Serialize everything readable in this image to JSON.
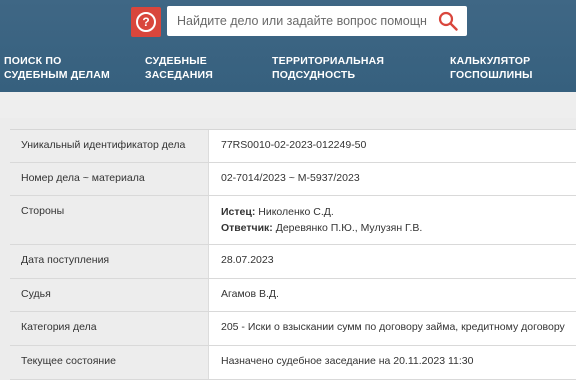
{
  "header": {
    "help_icon": "question-circle-icon",
    "search": {
      "placeholder": "Найдите дело или задайте вопрос помощнику",
      "value": ""
    },
    "search_icon": "search-icon",
    "nav": [
      {
        "label": "ПОИСК ПО\nСУДЕБНЫМ ДЕЛАМ"
      },
      {
        "label": "СУДЕБНЫЕ\nЗАСЕДАНИЯ"
      },
      {
        "label": "ТЕРРИТОРИАЛЬНАЯ\nПОДСУДНОСТЬ"
      },
      {
        "label": "КАЛЬКУЛЯТОР\nГОСПОШЛИНЫ"
      }
    ]
  },
  "case": {
    "id_label": "Уникальный идентификатор дела",
    "id_value": "77RS0010-02-2023-012249-50",
    "number_label": "Номер дела ~ материала",
    "number_value": "02-7014/2023 ~ М-5937/2023",
    "parties_label": "Стороны",
    "plaintiff_label": "Истец:",
    "plaintiff_value": "Николенко С.Д.",
    "defendant_label": "Ответчик:",
    "defendant_value": "Деревянко П.Ю., Мулузян Г.В.",
    "received_label": "Дата поступления",
    "received_value": "28.07.2023",
    "judge_label": "Судья",
    "judge_value": "Агамов В.Д.",
    "category_label": "Категория дела",
    "category_value": "205 - Иски о взыскании сумм по договору займа, кредитному договору",
    "status_label": "Текущее состояние",
    "status_value": "Назначено судебное заседание на 20.11.2023 11:30"
  },
  "colors": {
    "header": "#3b6483",
    "help_button": "#d9463c",
    "search_icon": "#d9463c"
  }
}
